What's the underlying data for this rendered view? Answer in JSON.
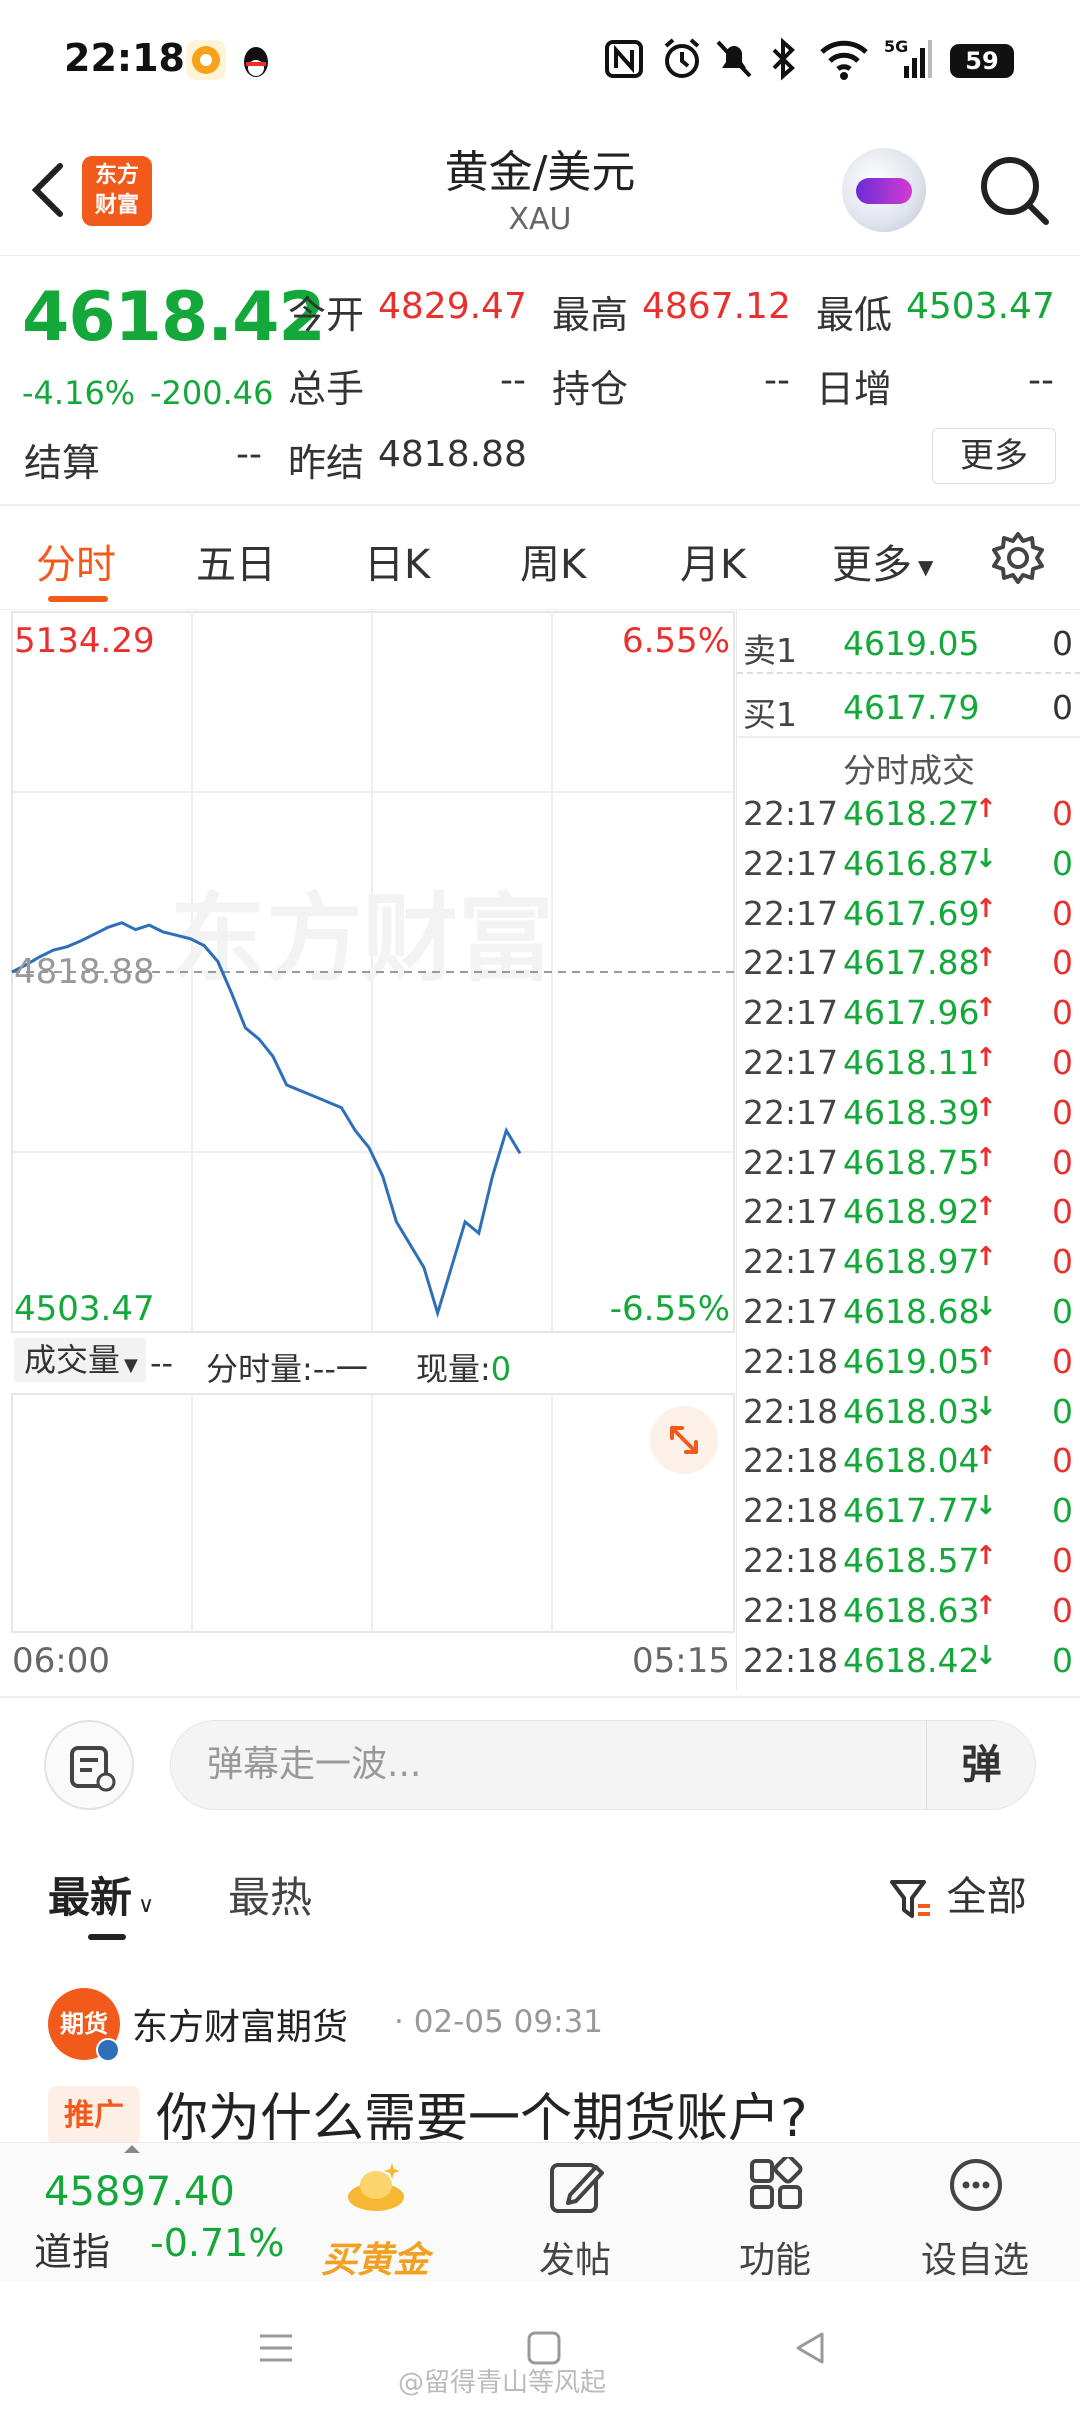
{
  "status_bar": {
    "time": "22:18",
    "battery": "59",
    "icons": [
      "app-icon-1",
      "qq-icon",
      "nfc-icon",
      "alarm-icon",
      "mute-icon",
      "bluetooth-icon",
      "wifi-icon",
      "5g-signal-icon"
    ]
  },
  "header": {
    "logo_text": "东方财富",
    "title": "黄金/美元",
    "subtitle": "XAU"
  },
  "quote": {
    "price": "4618.42",
    "pct": "-4.16%",
    "chg": "-200.46",
    "open_label": "今开",
    "open_value": "4829.47",
    "high_label": "最高",
    "high_value": "4867.12",
    "low_label": "最低",
    "low_value": "4503.47",
    "volume_label": "总手",
    "volume_value": "--",
    "oi_label": "持仓",
    "oi_value": "--",
    "daily_inc_label": "日增",
    "daily_inc_value": "--",
    "settle_label": "结算",
    "settle_value": "--",
    "prev_settle_label": "昨结",
    "prev_settle_value": "4818.88",
    "more_label": "更多"
  },
  "tabs": [
    "分时",
    "五日",
    "日K",
    "周K",
    "月K",
    "更多"
  ],
  "chart": {
    "top_price": "5134.29",
    "top_pct": "6.55%",
    "bottom_price": "4503.47",
    "bottom_pct": "-6.55%",
    "ref_price": "4818.88",
    "watermark": "东方财富",
    "volume_selector": "成交量",
    "volume_dash": "--",
    "minute_volume": "分时量:--一",
    "current_volume_label": "现量:",
    "current_volume_value": "0",
    "time_start": "06:00",
    "time_end": "05:15"
  },
  "chart_data": {
    "type": "line",
    "title": "",
    "xlabel": "",
    "ylabel": "",
    "ylim": [
      4503.47,
      5134.29
    ],
    "reference_line": 4818.88,
    "x_ticks": [
      "06:00",
      "05:15"
    ],
    "series": [
      {
        "values": [
          4818.9,
          4825,
          4832,
          4838,
          4841,
          4846,
          4852,
          4858,
          4862,
          4856,
          4860,
          4854,
          4851,
          4848,
          4842,
          4828,
          4800,
          4770,
          4760,
          4745,
          4720,
          4715,
          4710,
          4705,
          4700,
          4680,
          4665,
          4640,
          4600,
          4580,
          4560,
          4520,
          4560,
          4600,
          4590,
          4640,
          4680,
          4660
        ]
      }
    ]
  },
  "order_book": {
    "ask_label": "卖1",
    "ask_price": "4619.05",
    "ask_vol": "0",
    "bid_label": "买1",
    "bid_price": "4617.79",
    "bid_vol": "0",
    "ticks_title": "分时成交"
  },
  "ticks": [
    {
      "time": "22:17",
      "price": "4618.27",
      "dir": "up",
      "vol": "0"
    },
    {
      "time": "22:17",
      "price": "4616.87",
      "dir": "down",
      "vol": "0"
    },
    {
      "time": "22:17",
      "price": "4617.69",
      "dir": "up",
      "vol": "0"
    },
    {
      "time": "22:17",
      "price": "4617.88",
      "dir": "up",
      "vol": "0"
    },
    {
      "time": "22:17",
      "price": "4617.96",
      "dir": "up",
      "vol": "0"
    },
    {
      "time": "22:17",
      "price": "4618.11",
      "dir": "up",
      "vol": "0"
    },
    {
      "time": "22:17",
      "price": "4618.39",
      "dir": "up",
      "vol": "0"
    },
    {
      "time": "22:17",
      "price": "4618.75",
      "dir": "up",
      "vol": "0"
    },
    {
      "time": "22:17",
      "price": "4618.92",
      "dir": "up",
      "vol": "0"
    },
    {
      "time": "22:17",
      "price": "4618.97",
      "dir": "up",
      "vol": "0"
    },
    {
      "time": "22:17",
      "price": "4618.68",
      "dir": "down",
      "vol": "0"
    },
    {
      "time": "22:18",
      "price": "4619.05",
      "dir": "up",
      "vol": "0"
    },
    {
      "time": "22:18",
      "price": "4618.03",
      "dir": "down",
      "vol": "0"
    },
    {
      "time": "22:18",
      "price": "4618.04",
      "dir": "up",
      "vol": "0"
    },
    {
      "time": "22:18",
      "price": "4617.77",
      "dir": "down",
      "vol": "0"
    },
    {
      "time": "22:18",
      "price": "4618.57",
      "dir": "up",
      "vol": "0"
    },
    {
      "time": "22:18",
      "price": "4618.63",
      "dir": "up",
      "vol": "0"
    },
    {
      "time": "22:18",
      "price": "4618.42",
      "dir": "down",
      "vol": "0"
    }
  ],
  "danmaku": {
    "placeholder": "弹幕走一波...",
    "toggle_label": "弹"
  },
  "feed": {
    "latest_label": "最新",
    "hot_label": "最热",
    "filter_label": "全部"
  },
  "post": {
    "avatar_text": "期货",
    "author": "东方财富期货",
    "time": "· 02-05 09:31",
    "tag": "推广",
    "title": "你为什么需要一个期货账户?"
  },
  "bottom_nav": {
    "index_value": "45897.40",
    "index_label": "道指",
    "index_pct": "-0.71%",
    "items": [
      "买黄金",
      "发帖",
      "功能",
      "设自选"
    ]
  },
  "watermark": "@留得青山等风起",
  "colors": {
    "up": "#e8312f",
    "down": "#14a83b",
    "accent": "#f25a1c",
    "line": "#2f6fba"
  }
}
